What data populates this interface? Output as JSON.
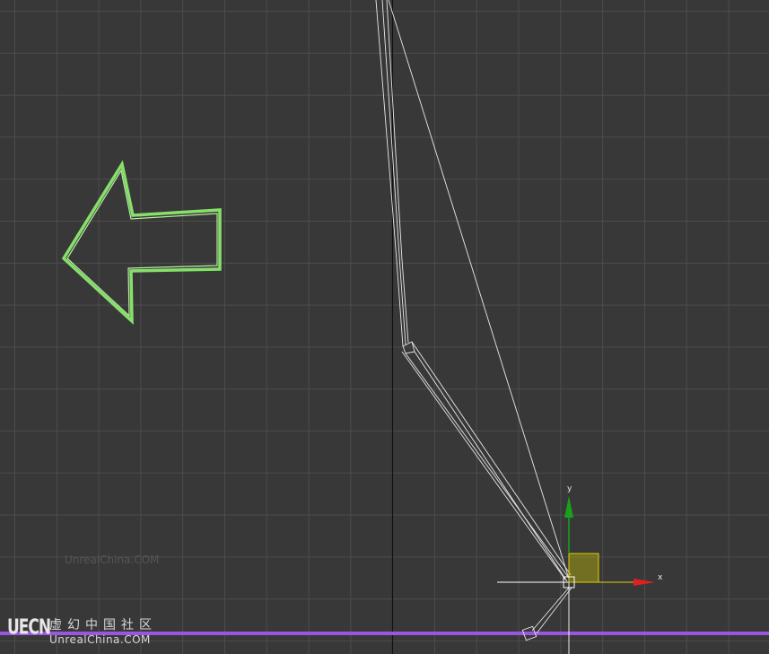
{
  "viewport": {
    "background": "#383838",
    "grid_color": "#4c4c4c",
    "ground_line_color": "#9a56e0"
  },
  "annotation": {
    "icon": "left-arrow-icon",
    "color": "#86e06a"
  },
  "gizmo": {
    "x_label": "x",
    "y_label": "y",
    "x_color": "#e02020",
    "y_color": "#1aa01a",
    "plane_color": "#e0d000"
  },
  "watermark": {
    "ghost_text": "UnrealChina.COM",
    "logo_mark": "UECN",
    "logo_chinese": "虚幻中国社区",
    "logo_english": "UnrealChina.COM"
  }
}
